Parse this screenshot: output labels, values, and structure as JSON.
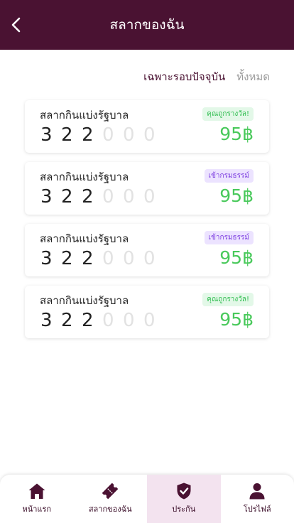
{
  "header": {
    "title": "สลากของฉัน"
  },
  "filters": {
    "current_round": "เฉพาะรอบปัจจุบัน",
    "all": "ทั้งหมด"
  },
  "tickets": [
    {
      "title": "สลากกินแบ่งรัฐบาล",
      "badge": "คุณถูกรางวัล!",
      "badge_type": "green",
      "digits": [
        "3",
        "2",
        "2",
        "0",
        "0",
        "0"
      ],
      "price": "95฿"
    },
    {
      "title": "สลากกินแบ่งรัฐบาล",
      "badge": "เข้ากรมธรรม์",
      "badge_type": "purple",
      "digits": [
        "3",
        "2",
        "2",
        "0",
        "0",
        "0"
      ],
      "price": "95฿"
    },
    {
      "title": "สลากกินแบ่งรัฐบาล",
      "badge": "เข้ากรมธรรม์",
      "badge_type": "purple",
      "digits": [
        "3",
        "2",
        "2",
        "0",
        "0",
        "0"
      ],
      "price": "95฿"
    },
    {
      "title": "สลากกินแบ่งรัฐบาล",
      "badge": "คุณถูกรางวัล!",
      "badge_type": "green",
      "digits": [
        "3",
        "2",
        "2",
        "0",
        "0",
        "0"
      ],
      "price": "95฿"
    }
  ],
  "nav": {
    "items": [
      {
        "label": "หน้าแรก",
        "icon": "home-icon"
      },
      {
        "label": "สลากของฉัน",
        "icon": "ticket-icon"
      },
      {
        "label": "ประกัน",
        "icon": "shield-check-icon",
        "active": true
      },
      {
        "label": "โปรไฟล์",
        "icon": "user-icon"
      }
    ]
  },
  "colors": {
    "header": "#4a1232",
    "price": "#49c95b",
    "active_nav": "#f3e3ef"
  }
}
